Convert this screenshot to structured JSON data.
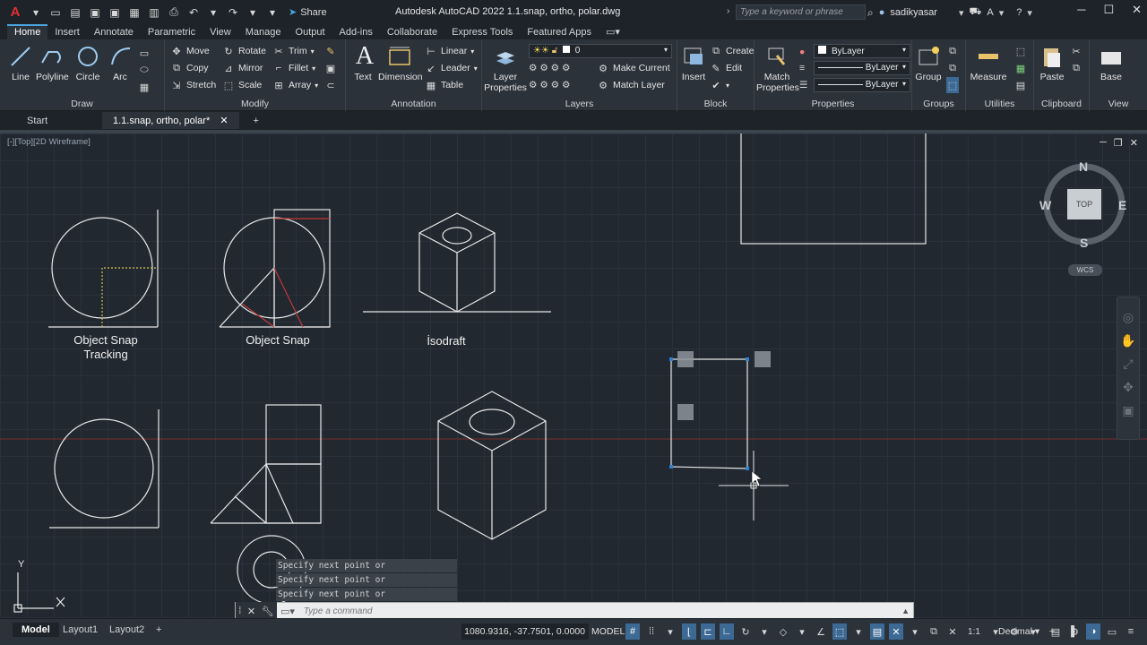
{
  "app": {
    "title": "Autodesk AutoCAD 2022    1.1.snap, ortho, polar.dwg",
    "share_label": "Share",
    "search_placeholder": "Type a keyword or phrase",
    "user": "sadikyasar"
  },
  "ribbon_tabs": [
    "Home",
    "Insert",
    "Annotate",
    "Parametric",
    "View",
    "Manage",
    "Output",
    "Add-ins",
    "Collaborate",
    "Express Tools",
    "Featured Apps"
  ],
  "ribbon": {
    "draw": {
      "title": "Draw",
      "line": "Line",
      "polyline": "Polyline",
      "circle": "Circle",
      "arc": "Arc"
    },
    "modify": {
      "title": "Modify",
      "move": "Move",
      "rotate": "Rotate",
      "trim": "Trim",
      "copy": "Copy",
      "mirror": "Mirror",
      "fillet": "Fillet",
      "stretch": "Stretch",
      "scale": "Scale",
      "array": "Array"
    },
    "annotation": {
      "title": "Annotation",
      "text": "Text",
      "dimension": "Dimension",
      "linear": "Linear",
      "leader": "Leader",
      "table": "Table"
    },
    "layers": {
      "title": "Layers",
      "layer_properties": "Layer Properties",
      "layer_value": "0",
      "make_current": "Make Current",
      "match_layer": "Match Layer"
    },
    "block": {
      "title": "Block",
      "insert": "Insert",
      "create": "Create",
      "edit": "Edit"
    },
    "properties": {
      "title": "Properties",
      "match_properties": "Match Properties",
      "color": "ByLayer",
      "lineweight": "ByLayer",
      "linetype": "ByLayer"
    },
    "groups": {
      "title": "Groups",
      "group": "Group"
    },
    "utilities": {
      "title": "Utilities",
      "measure": "Measure"
    },
    "clipboard": {
      "title": "Clipboard",
      "paste": "Paste"
    },
    "view": {
      "title": "View",
      "base": "Base"
    }
  },
  "doc_tabs": {
    "start": "Start",
    "active": "1.1.snap, ortho, polar*"
  },
  "viewport": {
    "label": "[-][Top][2D Wireframe]",
    "labels": {
      "object_snap_tracking": "Object Snap\nTracking",
      "object_snap": "Object Snap",
      "isodraft": "İsodraft"
    }
  },
  "viewcube": {
    "north": "N",
    "south": "S",
    "east": "E",
    "west": "W",
    "top": "TOP",
    "wcs": "WCS"
  },
  "ucs": {
    "y": "Y",
    "x": "X"
  },
  "command": {
    "history": [
      "Specify next point or [Close/Undo]:",
      "Specify next point or [Close/Undo]:",
      "Specify next point or [Close/Undo]:"
    ],
    "placeholder": "Type a command"
  },
  "status": {
    "layouts": [
      "Model",
      "Layout1",
      "Layout2"
    ],
    "coordinates": "1080.9316, -37.7501, 0.0000",
    "space": "MODEL",
    "scale": "1:1",
    "units": "Decimal"
  }
}
